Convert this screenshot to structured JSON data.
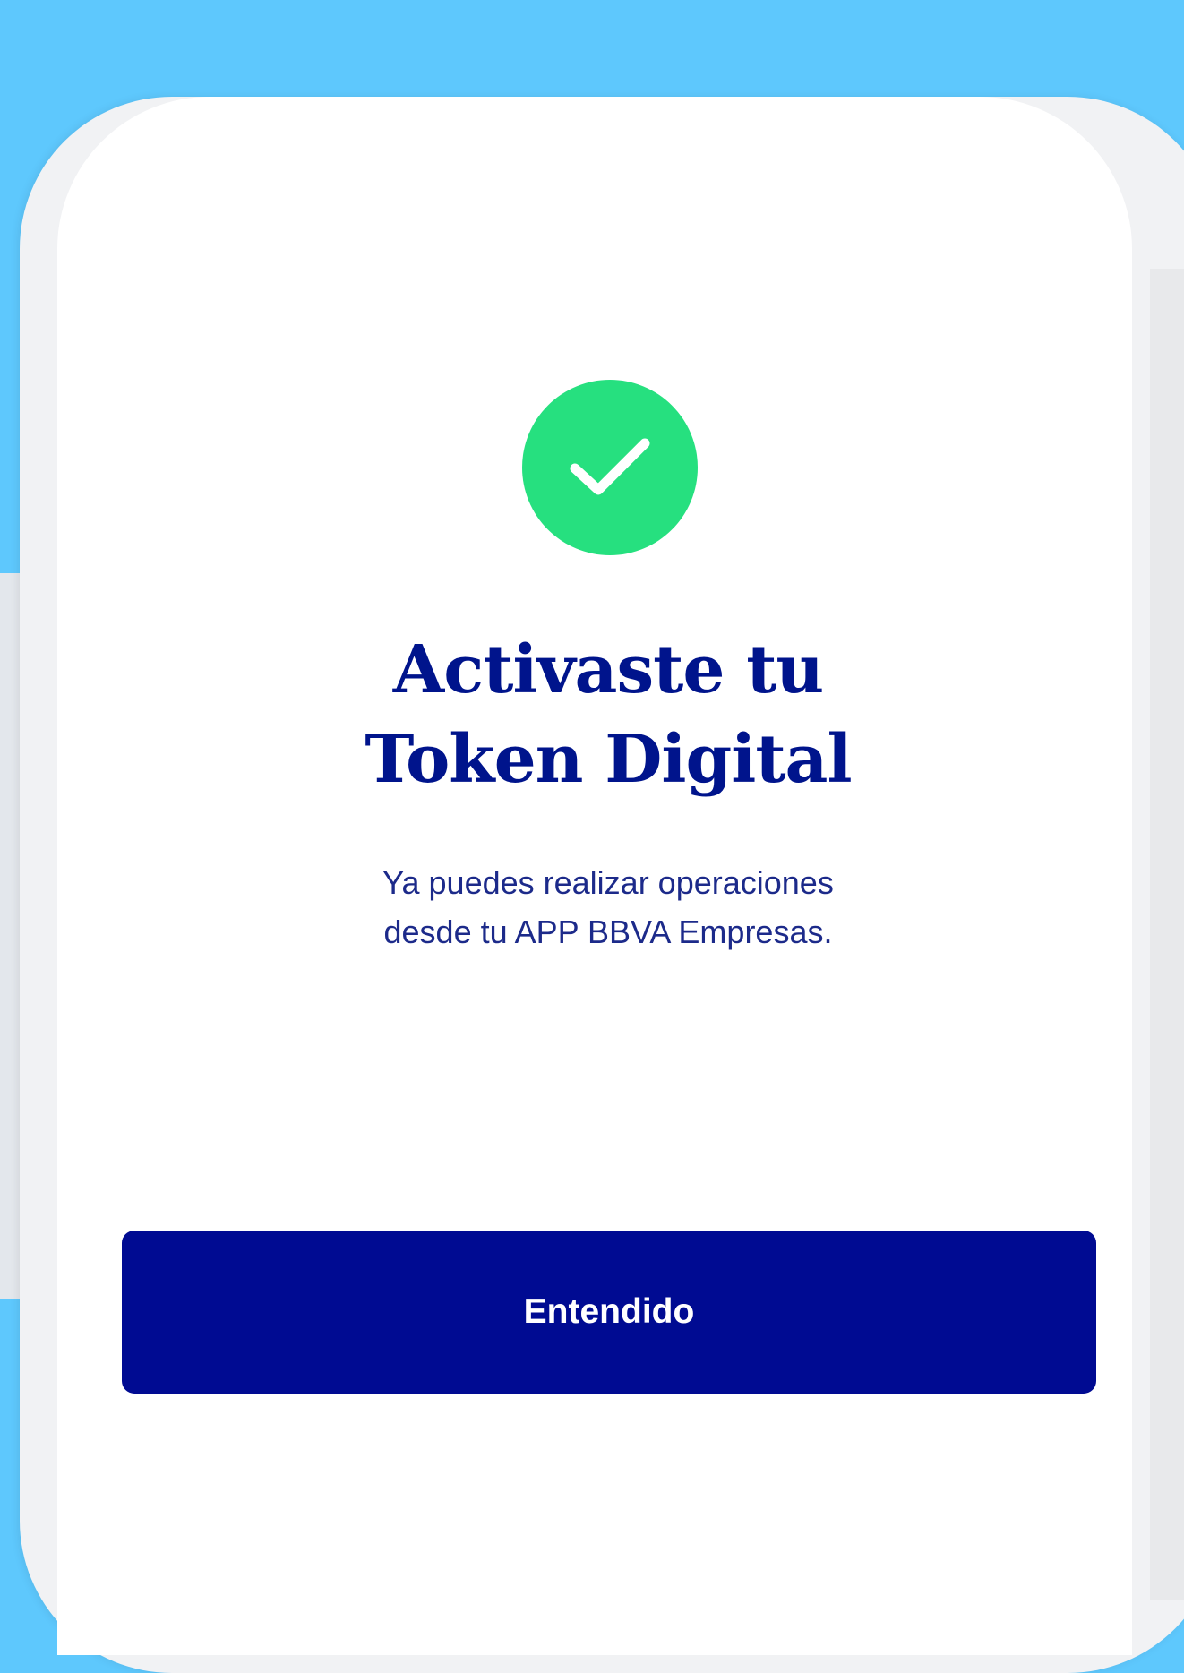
{
  "success_dialog": {
    "title_line1": "Activaste tu",
    "title_line2": "Token Digital",
    "message_line1": "Ya puedes realizar operaciones",
    "message_line2": "desde tu APP BBVA Empresas.",
    "confirm_label": "Entendido",
    "icon": "checkmark-circle-icon"
  },
  "colors": {
    "background": "#5ec8fd",
    "success": "#26e07f",
    "primary": "#000b92",
    "title": "#00148c"
  }
}
